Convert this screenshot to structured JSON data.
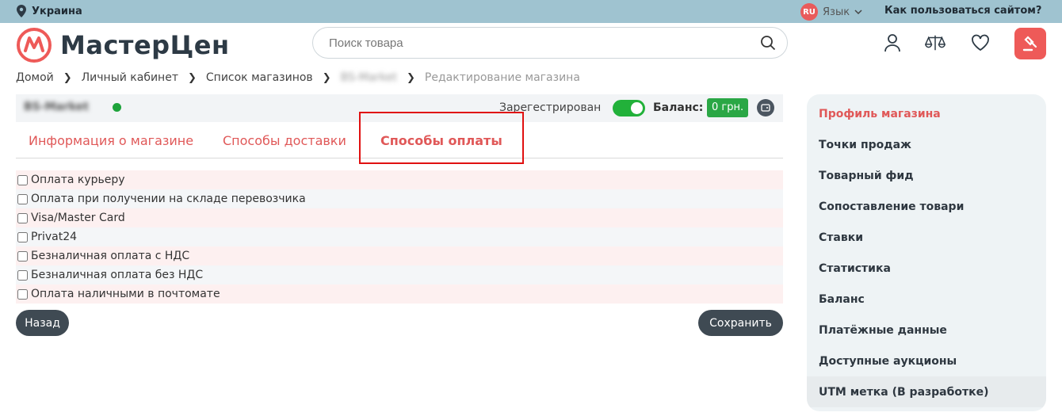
{
  "topbar": {
    "region": "Украина",
    "lang_code": "RU",
    "lang_label": "Язык",
    "help": "Как пользоваться сайтом?"
  },
  "header": {
    "logo_text": "МастерЦен",
    "search_placeholder": "Поиск товара"
  },
  "breadcrumb": {
    "items": [
      "Домой",
      "Личный кабинет",
      "Список магазинов",
      "BS-Market",
      "Редактирование магазина"
    ]
  },
  "shop": {
    "name": "BS-Market",
    "registered_label": "Зарегестрирован",
    "balance_label": "Баланс:",
    "balance_value": "0 грн."
  },
  "tabs": [
    {
      "label": "Информация о магазине"
    },
    {
      "label": "Способы доставки"
    },
    {
      "label": "Способы оплаты"
    }
  ],
  "payment_options": [
    {
      "label": "Оплата курьеру"
    },
    {
      "label": "Оплата при получении на складе перевозчика"
    },
    {
      "label": "Visa/Master Card"
    },
    {
      "label": "Privat24"
    },
    {
      "label": "Безналичная оплата с НДС"
    },
    {
      "label": "Безналичная оплата без НДС"
    },
    {
      "label": "Оплата наличными в почтомате"
    }
  ],
  "buttons": {
    "back": "Назад",
    "save": "Сохранить"
  },
  "sidebar": {
    "items": [
      {
        "label": "Профиль магазина"
      },
      {
        "label": "Точки продаж"
      },
      {
        "label": "Товарный фид"
      },
      {
        "label": "Сопоставление товари"
      },
      {
        "label": "Ставки"
      },
      {
        "label": "Статистика"
      },
      {
        "label": "Баланс"
      },
      {
        "label": "Платёжные данные"
      },
      {
        "label": "Доступные аукционы"
      },
      {
        "label": "UTM метка (В разработке)"
      }
    ]
  },
  "colors": {
    "accent": "#e05858",
    "topbar": "#9fc3d0",
    "success": "#22b13a",
    "dark_button": "#3f4a53"
  }
}
